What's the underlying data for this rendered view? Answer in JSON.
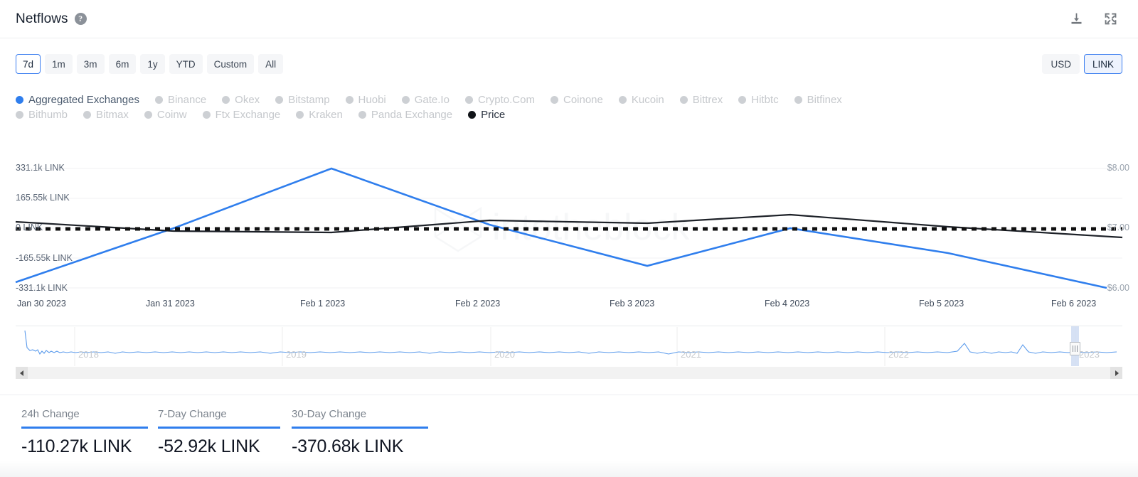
{
  "header": {
    "title": "Netflows",
    "help_icon": "question-mark-icon",
    "download_icon": "download-icon",
    "fullscreen_icon": "fullscreen-icon"
  },
  "controls": {
    "ranges": [
      {
        "label": "7d",
        "active": true
      },
      {
        "label": "1m",
        "active": false
      },
      {
        "label": "3m",
        "active": false
      },
      {
        "label": "6m",
        "active": false
      },
      {
        "label": "1y",
        "active": false
      },
      {
        "label": "YTD",
        "active": false
      },
      {
        "label": "Custom",
        "active": false
      },
      {
        "label": "All",
        "active": false
      }
    ],
    "units": [
      {
        "label": "USD",
        "active": false
      },
      {
        "label": "LINK",
        "active": true
      }
    ]
  },
  "legend": {
    "row1": [
      {
        "label": "Aggregated Exchanges",
        "state": "on-blue"
      },
      {
        "label": "Binance",
        "state": "off"
      },
      {
        "label": "Okex",
        "state": "off"
      },
      {
        "label": "Bitstamp",
        "state": "off"
      },
      {
        "label": "Huobi",
        "state": "off"
      },
      {
        "label": "Gate.Io",
        "state": "off"
      },
      {
        "label": "Crypto.Com",
        "state": "off"
      },
      {
        "label": "Coinone",
        "state": "off"
      },
      {
        "label": "Kucoin",
        "state": "off"
      },
      {
        "label": "Bittrex",
        "state": "off"
      },
      {
        "label": "Hitbtc",
        "state": "off"
      },
      {
        "label": "Bitfinex",
        "state": "off"
      }
    ],
    "row2": [
      {
        "label": "Bithumb",
        "state": "off"
      },
      {
        "label": "Bitmax",
        "state": "off"
      },
      {
        "label": "Coinw",
        "state": "off"
      },
      {
        "label": "Ftx Exchange",
        "state": "off"
      },
      {
        "label": "Kraken",
        "state": "off"
      },
      {
        "label": "Panda Exchange",
        "state": "off"
      },
      {
        "label": "Price",
        "state": "on-black"
      }
    ]
  },
  "watermark": "intotheblock",
  "chart_data": {
    "type": "line",
    "title": "Netflows",
    "xlabel": "",
    "ylabel": "LINK",
    "grid": true,
    "legend_position": "top",
    "x": [
      "Jan 30 2023",
      "Jan 31 2023",
      "Feb 1 2023",
      "Feb 2 2023",
      "Feb 3 2023",
      "Feb 4 2023",
      "Feb 5 2023",
      "Feb 6 2023"
    ],
    "left_axis": {
      "ticks": [
        "331.1k LINK",
        "165.55k LINK",
        "0 LINK",
        "-165.55k LINK",
        "-331.1k LINK"
      ],
      "values": [
        331100,
        165550,
        0,
        -165550,
        -331100
      ],
      "ylim": [
        -331100,
        331100
      ]
    },
    "right_axis": {
      "ticks": [
        "$8.00",
        "$7.00",
        "$6.00"
      ],
      "values": [
        8.0,
        7.0,
        6.0
      ],
      "ylim": [
        5.7,
        8.15
      ]
    },
    "series": [
      {
        "name": "Aggregated Exchanges",
        "color": "#2f7eed",
        "axis": "left",
        "unit": "LINK",
        "values": [
          -310000,
          0,
          331100,
          20000,
          -212000,
          0,
          -150000,
          -315000
        ]
      },
      {
        "name": "Price",
        "color": "#1d2128",
        "axis": "right",
        "unit": "USD",
        "values": [
          7.02,
          6.98,
          6.99,
          7.11,
          7.09,
          7.16,
          7.04,
          6.94
        ]
      },
      {
        "name": "Zero Baseline",
        "color": "#111111",
        "axis": "left",
        "style": "dotted",
        "values": [
          0,
          0,
          0,
          0,
          0,
          0,
          0,
          0
        ]
      }
    ]
  },
  "navigator": {
    "years": [
      "2018",
      "2019",
      "2020",
      "2021",
      "2022",
      "2023"
    ],
    "left_arrow": "arrow-left-icon",
    "right_arrow": "arrow-right-icon"
  },
  "stats": [
    {
      "label": "24h Change",
      "value": "-110.27k LINK"
    },
    {
      "label": "7-Day Change",
      "value": "-52.92k LINK"
    },
    {
      "label": "30-Day Change",
      "value": "-370.68k LINK"
    }
  ],
  "colors": {
    "accent_blue": "#2f7eed",
    "price_black": "#1d2128",
    "muted_gray": "#c5c8cc"
  }
}
